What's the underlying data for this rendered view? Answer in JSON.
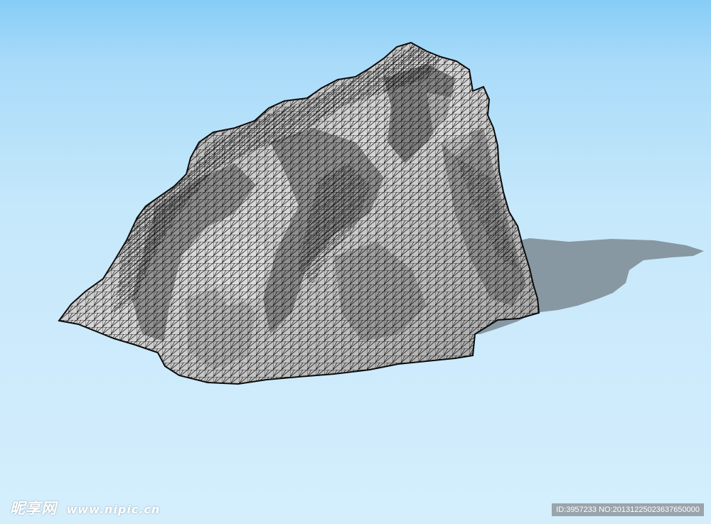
{
  "scene": {
    "description_colors": {
      "sky_top": "#86cdf7",
      "sky_bottom": "#d4eefc",
      "rock_fill": "#bdbdbd",
      "rock_shade": "#6e6e6e",
      "mesh_line": "#111111",
      "shadow": "#7f8f98"
    },
    "subject_icon": "wireframe-rock-mesh"
  },
  "watermark": {
    "logo_cn": "昵享网",
    "url": "www.nipic.cn"
  },
  "image_id": {
    "text": "ID:3957233 NO:20131225023637650000"
  }
}
